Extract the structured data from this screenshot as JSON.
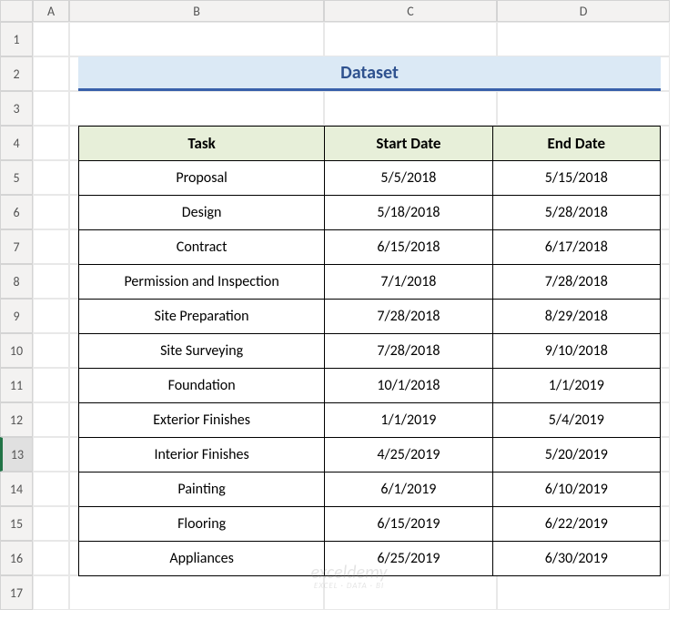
{
  "columns": [
    "A",
    "B",
    "C",
    "D"
  ],
  "rowCount": 17,
  "activeRow": 13,
  "title": "Dataset",
  "headers": {
    "task": "Task",
    "start": "Start Date",
    "end": "End Date"
  },
  "rows": [
    {
      "task": "Proposal",
      "start": "5/5/2018",
      "end": "5/15/2018"
    },
    {
      "task": "Design",
      "start": "5/18/2018",
      "end": "5/28/2018"
    },
    {
      "task": "Contract",
      "start": "6/15/2018",
      "end": "6/17/2018"
    },
    {
      "task": "Permission and Inspection",
      "start": "7/1/2018",
      "end": "7/28/2018"
    },
    {
      "task": "Site Preparation",
      "start": "7/28/2018",
      "end": "8/29/2018"
    },
    {
      "task": "Site Surveying",
      "start": "7/28/2018",
      "end": "9/10/2018"
    },
    {
      "task": "Foundation",
      "start": "10/1/2018",
      "end": "1/1/2019"
    },
    {
      "task": "Exterior Finishes",
      "start": "1/1/2019",
      "end": "5/4/2019"
    },
    {
      "task": "Interior Finishes",
      "start": "4/25/2019",
      "end": "5/20/2019"
    },
    {
      "task": "Painting",
      "start": "6/1/2019",
      "end": "6/10/2019"
    },
    {
      "task": "Flooring",
      "start": "6/15/2019",
      "end": "6/22/2019"
    },
    {
      "task": "Appliances",
      "start": "6/25/2019",
      "end": "6/30/2019"
    }
  ],
  "watermark": {
    "main": "exceldemy",
    "sub": "EXCEL · DATA · BI"
  }
}
